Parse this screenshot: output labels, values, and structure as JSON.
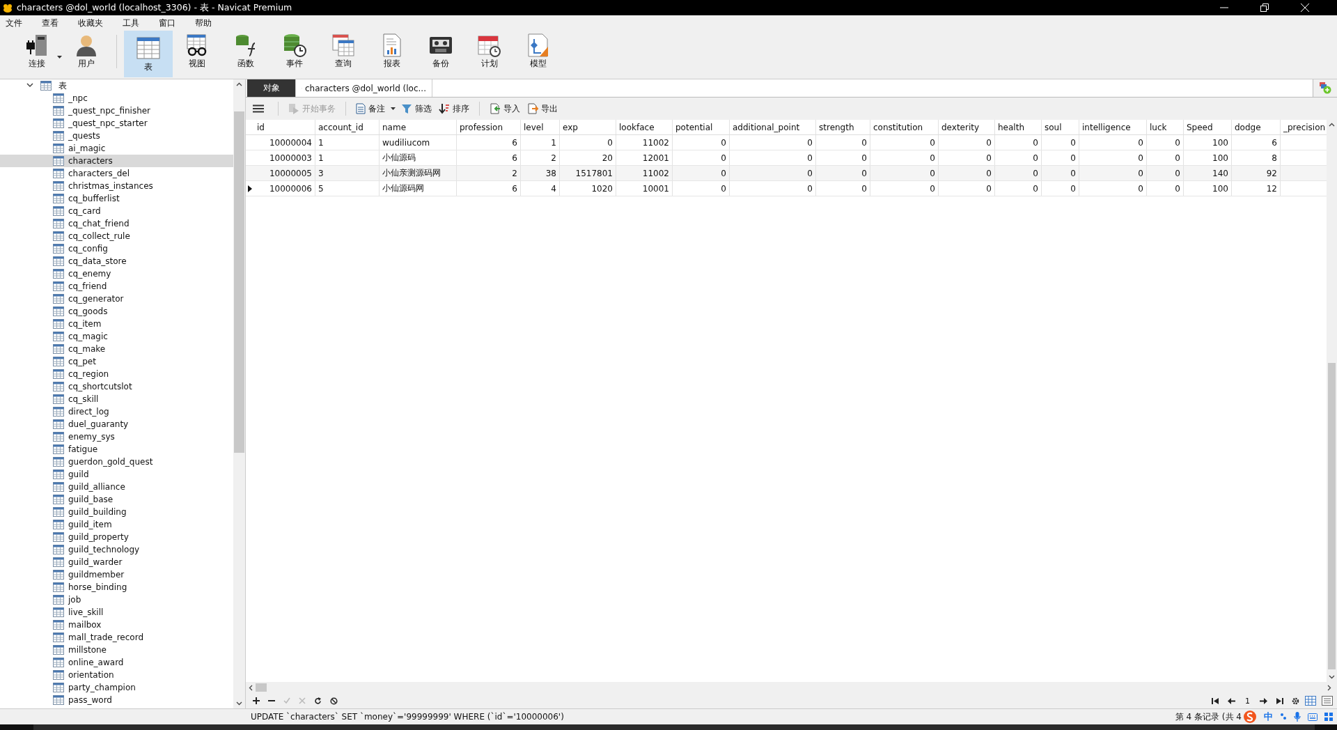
{
  "window": {
    "title": "characters @dol_world (localhost_3306) - 表 - Navicat Premium"
  },
  "menu": [
    "文件",
    "查看",
    "收藏夹",
    "工具",
    "窗口",
    "帮助"
  ],
  "toolbar": [
    {
      "label": "连接",
      "kind": "connect",
      "selected": false
    },
    {
      "label": "用户",
      "kind": "user",
      "selected": false
    },
    {
      "label": "表",
      "kind": "table",
      "selected": true
    },
    {
      "label": "视图",
      "kind": "view",
      "selected": false
    },
    {
      "label": "函数",
      "kind": "function",
      "selected": false
    },
    {
      "label": "事件",
      "kind": "event",
      "selected": false
    },
    {
      "label": "查询",
      "kind": "query",
      "selected": false
    },
    {
      "label": "报表",
      "kind": "report",
      "selected": false
    },
    {
      "label": "备份",
      "kind": "backup",
      "selected": false
    },
    {
      "label": "计划",
      "kind": "schedule",
      "selected": false
    },
    {
      "label": "模型",
      "kind": "model",
      "selected": false
    }
  ],
  "navigator": {
    "label": "表",
    "expanded": true,
    "children": [
      {
        "label": "_npc",
        "selected": false
      },
      {
        "label": "_quest_npc_finisher",
        "selected": false
      },
      {
        "label": "_quest_npc_starter",
        "selected": false
      },
      {
        "label": "_quests",
        "selected": false
      },
      {
        "label": "ai_magic",
        "selected": false
      },
      {
        "label": "characters",
        "selected": true
      },
      {
        "label": "characters_del",
        "selected": false
      },
      {
        "label": "christmas_instances",
        "selected": false
      },
      {
        "label": "cq_bufferlist",
        "selected": false
      },
      {
        "label": "cq_card",
        "selected": false
      },
      {
        "label": "cq_chat_friend",
        "selected": false
      },
      {
        "label": "cq_collect_rule",
        "selected": false
      },
      {
        "label": "cq_config",
        "selected": false
      },
      {
        "label": "cq_data_store",
        "selected": false
      },
      {
        "label": "cq_enemy",
        "selected": false
      },
      {
        "label": "cq_friend",
        "selected": false
      },
      {
        "label": "cq_generator",
        "selected": false
      },
      {
        "label": "cq_goods",
        "selected": false
      },
      {
        "label": "cq_item",
        "selected": false
      },
      {
        "label": "cq_magic",
        "selected": false
      },
      {
        "label": "cq_make",
        "selected": false
      },
      {
        "label": "cq_pet",
        "selected": false
      },
      {
        "label": "cq_region",
        "selected": false
      },
      {
        "label": "cq_shortcutslot",
        "selected": false
      },
      {
        "label": "cq_skill",
        "selected": false
      },
      {
        "label": "direct_log",
        "selected": false
      },
      {
        "label": "duel_guaranty",
        "selected": false
      },
      {
        "label": "enemy_sys",
        "selected": false
      },
      {
        "label": "fatigue",
        "selected": false
      },
      {
        "label": "guerdon_gold_quest",
        "selected": false
      },
      {
        "label": "guild",
        "selected": false
      },
      {
        "label": "guild_alliance",
        "selected": false
      },
      {
        "label": "guild_base",
        "selected": false
      },
      {
        "label": "guild_building",
        "selected": false
      },
      {
        "label": "guild_item",
        "selected": false
      },
      {
        "label": "guild_property",
        "selected": false
      },
      {
        "label": "guild_technology",
        "selected": false
      },
      {
        "label": "guild_warder",
        "selected": false
      },
      {
        "label": "guildmember",
        "selected": false
      },
      {
        "label": "horse_binding",
        "selected": false
      },
      {
        "label": "job",
        "selected": false
      },
      {
        "label": "live_skill",
        "selected": false
      },
      {
        "label": "mailbox",
        "selected": false
      },
      {
        "label": "mall_trade_record",
        "selected": false
      },
      {
        "label": "millstone",
        "selected": false
      },
      {
        "label": "online_award",
        "selected": false
      },
      {
        "label": "orientation",
        "selected": false
      },
      {
        "label": "party_champion",
        "selected": false
      },
      {
        "label": "pass_word",
        "selected": false
      }
    ]
  },
  "tabs": [
    {
      "label": "对象",
      "kind": "objects",
      "selected": false
    },
    {
      "label": "characters @dol_world (loc...",
      "kind": "table",
      "selected": true
    }
  ],
  "grid_toolbar": [
    {
      "label": "开始事务",
      "kind": "begin",
      "disabled": true
    },
    {
      "label": "备注",
      "kind": "memo",
      "disabled": false
    },
    {
      "label": "筛选",
      "kind": "filter",
      "disabled": false
    },
    {
      "label": "排序",
      "kind": "sort",
      "disabled": false
    },
    {
      "label": "导入",
      "kind": "import",
      "disabled": false
    },
    {
      "label": "导出",
      "kind": "export",
      "disabled": false
    }
  ],
  "table": {
    "columns": [
      {
        "label": "id",
        "kind": "number"
      },
      {
        "label": "account_id",
        "kind": "text"
      },
      {
        "label": "name",
        "kind": "text"
      },
      {
        "label": "profession",
        "kind": "number"
      },
      {
        "label": "level",
        "kind": "number"
      },
      {
        "label": "exp",
        "kind": "number"
      },
      {
        "label": "lookface",
        "kind": "number"
      },
      {
        "label": "potential",
        "kind": "number"
      },
      {
        "label": "additional_point",
        "kind": "number"
      },
      {
        "label": "strength",
        "kind": "number"
      },
      {
        "label": "constitution",
        "kind": "number"
      },
      {
        "label": "dexterity",
        "kind": "number"
      },
      {
        "label": "health",
        "kind": "number"
      },
      {
        "label": "soul",
        "kind": "number"
      },
      {
        "label": "intelligence",
        "kind": "number"
      },
      {
        "label": "luck",
        "kind": "number"
      },
      {
        "label": "Speed",
        "kind": "number"
      },
      {
        "label": "dodge",
        "kind": "number"
      },
      {
        "label": "_precision"
      }
    ],
    "rows": [
      {
        "selected": false,
        "cells": [
          "10000004",
          "1",
          "wudiliucom",
          "6",
          "1",
          "0",
          "11002",
          "0",
          "0",
          "0",
          "0",
          "0",
          "0",
          "0",
          "0",
          "0",
          "100",
          "6"
        ]
      },
      {
        "selected": false,
        "cells": [
          "10000003",
          "1",
          "小仙源码",
          "6",
          "2",
          "20",
          "12001",
          "0",
          "0",
          "0",
          "0",
          "0",
          "0",
          "0",
          "0",
          "0",
          "100",
          "8"
        ]
      },
      {
        "selected": false,
        "cells": [
          "10000005",
          "3",
          "小仙亲测源码网",
          "2",
          "38",
          "1517801",
          "11002",
          "0",
          "0",
          "0",
          "0",
          "0",
          "0",
          "0",
          "0",
          "0",
          "140",
          "92"
        ]
      },
      {
        "selected": true,
        "cells": [
          "10000006",
          "5",
          "小仙源码网",
          "6",
          "4",
          "1020",
          "10001",
          "0",
          "0",
          "0",
          "0",
          "0",
          "0",
          "0",
          "0",
          "0",
          "100",
          "12"
        ]
      }
    ]
  },
  "navigation": {
    "page": "1"
  },
  "status_bar": {
    "sql": "UPDATE `characters` SET `money`='99999999' WHERE (`id`='10000006')",
    "record": "第 4 条记录 (共 4"
  },
  "ime": {
    "label": "中"
  }
}
